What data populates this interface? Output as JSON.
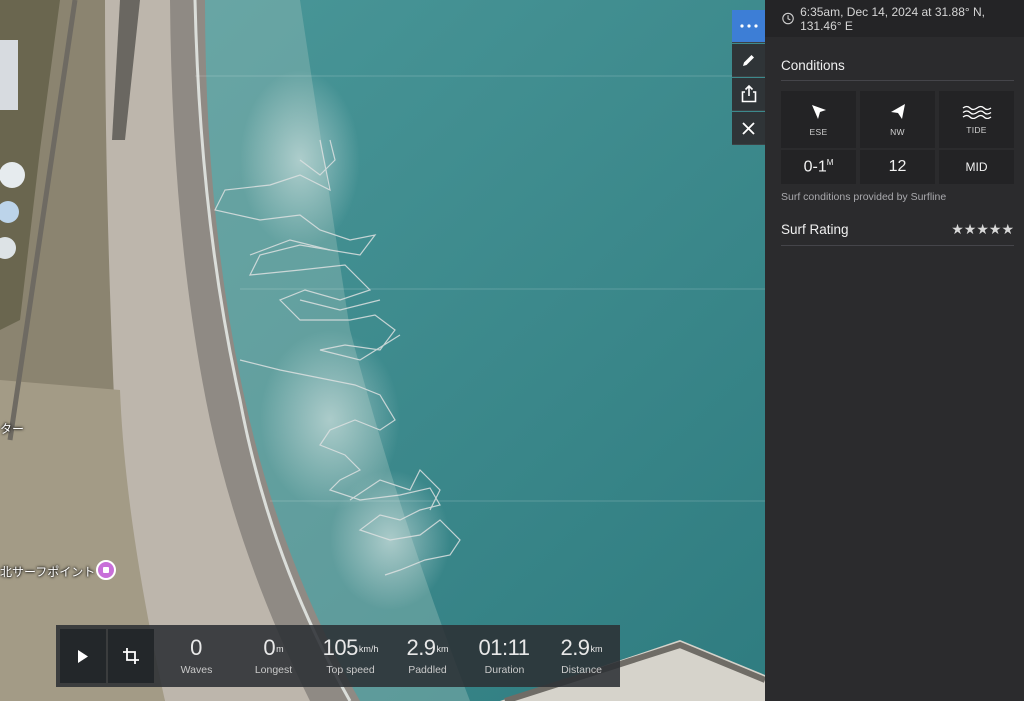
{
  "map": {
    "label_partial": "ター",
    "poi_label": "北サーフポイント",
    "colors": {
      "sea": "#3f8a8d",
      "beach": "#b9b2a8",
      "land": "#8d8672",
      "track": "#d9dcdc"
    }
  },
  "controls": {
    "more_icon": "ellipsis-icon",
    "edit_icon": "pencil-icon",
    "share_icon": "share-icon",
    "close_icon": "close-icon"
  },
  "stats": [
    {
      "value": "0",
      "unit": "",
      "label": "Waves"
    },
    {
      "value": "0",
      "unit": "m",
      "label": "Longest"
    },
    {
      "value": "105",
      "unit": "km/h",
      "label": "Top speed"
    },
    {
      "value": "2.9",
      "unit": "km",
      "label": "Paddled"
    },
    {
      "value": "01:11",
      "unit": "",
      "label": "Duration"
    },
    {
      "value": "2.9",
      "unit": "km",
      "label": "Distance"
    }
  ],
  "panel": {
    "header": "6:35am, Dec 14, 2024 at 31.88° N, 131.46° E",
    "conditions_title": "Conditions",
    "conditions": {
      "swell_dir": "ESE",
      "wind_dir": "NW",
      "tide_label": "TIDE",
      "wave_height": "0-1",
      "wave_unit": "M",
      "wind_speed": "12",
      "tide_value": "MID"
    },
    "credit": "Surf conditions provided by Surfline",
    "rating_title": "Surf Rating",
    "stars": "★★★★★",
    "accent": "#3d7ed6"
  }
}
